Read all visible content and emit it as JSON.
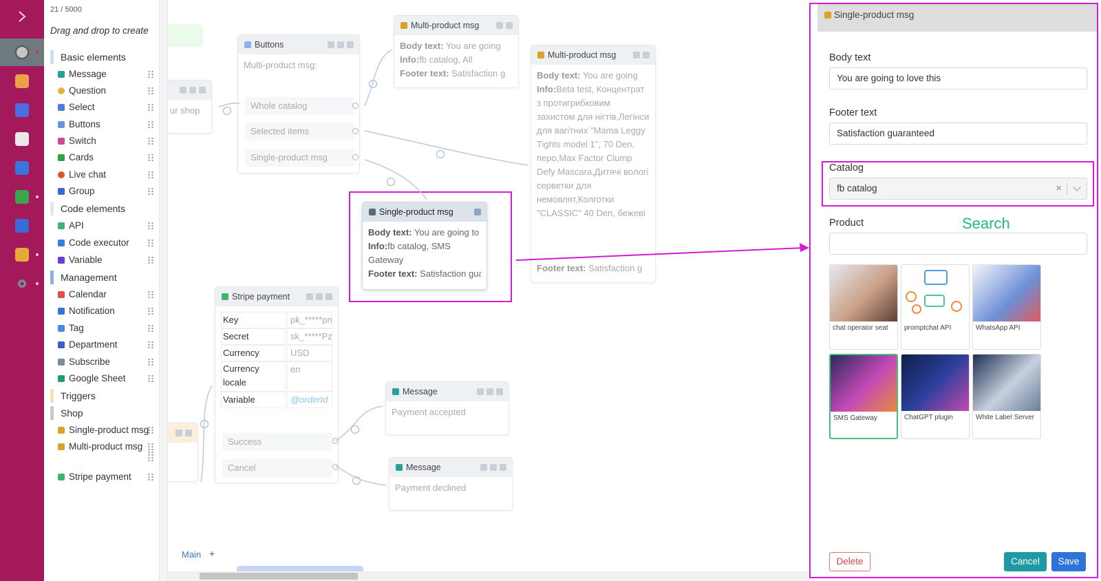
{
  "elements_panel": {
    "counter": "21 / 5000",
    "hint": "Drag and drop to create",
    "categories": {
      "basic": "Basic elements",
      "code": "Code elements",
      "management": "Management",
      "triggers": "Triggers",
      "shop": "Shop"
    },
    "basic": [
      "Message",
      "Question",
      "Select",
      "Buttons",
      "Switch",
      "Cards",
      "Live chat",
      "Group"
    ],
    "code": [
      "API",
      "Code executor",
      "Variable"
    ],
    "management": [
      "Calendar",
      "Notification",
      "Tag",
      "Department",
      "Subscribe",
      "Google Sheet"
    ],
    "shop": [
      "Single-product msg",
      "Multi-product msg",
      "Stripe payment"
    ]
  },
  "canvas": {
    "partial_node_text": "ur shop",
    "buttons_node": {
      "title": "Buttons",
      "body": "Multi-product msg:",
      "ports": [
        "Whole catalog",
        "Selected items",
        "Single-product msg"
      ]
    },
    "multi1": {
      "title": "Multi-product msg",
      "body_label": "Body text:",
      "body_value": "You are going",
      "info_label": "Info:",
      "info_value": "fb catalog, All",
      "footer_label": "Footer text:",
      "footer_value": "Satisfaction g"
    },
    "multi2": {
      "title": "Multi-product msg",
      "body_label": "Body text:",
      "body_value": "You are going",
      "info_label": "Info:",
      "info_value": "Beta test, Концентрат з протигрибковим захистом для нігтів,Легінси для вагітних \"Mama Leggy Tights model 1\", 70 Den, перо,Max Factor Clump Defy Mascara,Дитячі вологі серветки для немовлят,Колготки \"CLASSIC\" 40 Den, бежеві",
      "footer_label": "Footer text:",
      "footer_value": "Satisfaction g"
    },
    "single": {
      "title": "Single-product msg",
      "body_label": "Body text:",
      "body_value": "You are going to lo",
      "info_label": "Info:",
      "info_value": "fb catalog, SMS Gateway",
      "footer_label": "Footer text:",
      "footer_value": "Satisfaction gua"
    },
    "stripe": {
      "title": "Stripe payment",
      "rows": [
        {
          "k": "Key",
          "v": "pk_*****pn"
        },
        {
          "k": "Secret",
          "v": "sk_*****Pz"
        },
        {
          "k": "Currency",
          "v": "USD"
        },
        {
          "k": "Currency locale",
          "v": "en"
        },
        {
          "k": "Variable",
          "v": "@orderId"
        }
      ],
      "ports": [
        "Success",
        "Cancel"
      ]
    },
    "msg_accepted": {
      "title": "Message",
      "body": "Payment accepted"
    },
    "msg_declined": {
      "title": "Message",
      "body": "Payment declined"
    },
    "tab_main": "Main",
    "tab_add": "+"
  },
  "panel": {
    "title": "Single-product msg",
    "body_label": "Body text",
    "body_value": "You are going to love this",
    "footer_label": "Footer text",
    "footer_value": "Satisfaction guaranteed",
    "catalog_label": "Catalog",
    "catalog_value": "fb catalog",
    "catalog_clear": "×",
    "product_label": "Product",
    "search_annotation": "Search",
    "products": [
      "chat operator seat",
      "promptchat API",
      "WhatsApp API",
      "SMS Gateway",
      "ChatGPT plugin",
      "White Label Server"
    ],
    "selected_product": "SMS Gateway",
    "delete": "Delete",
    "cancel": "Cancel",
    "save": "Save"
  },
  "colors": {
    "rail": "#a3195b",
    "highlight": "#d21bd7",
    "annotation": "#1eb88a",
    "primary": "#2f72d8",
    "teal": "#1f9aa5"
  }
}
